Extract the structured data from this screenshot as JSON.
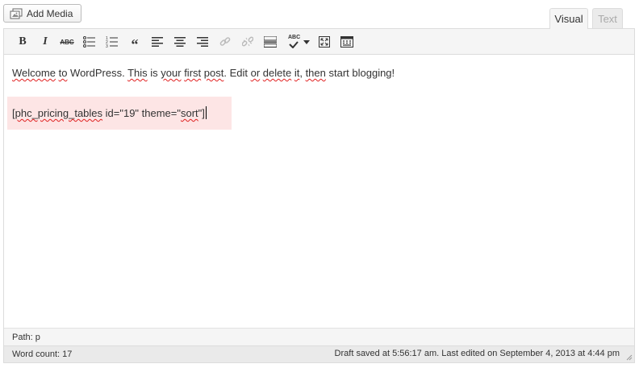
{
  "toolbar_top": {
    "add_media_label": "Add Media"
  },
  "tabs": {
    "visual": "Visual",
    "text": "Text"
  },
  "editor_toolbar": {
    "buttons": [
      {
        "name": "bold",
        "icon": "bold-icon"
      },
      {
        "name": "italic",
        "icon": "italic-icon"
      },
      {
        "name": "strikethrough",
        "icon": "strikethrough-icon",
        "glyph": "ABC"
      },
      {
        "name": "bulleted-list",
        "icon": "bulleted-list-icon"
      },
      {
        "name": "numbered-list",
        "icon": "numbered-list-icon"
      },
      {
        "name": "blockquote",
        "icon": "blockquote-icon"
      },
      {
        "name": "align-left",
        "icon": "align-left-icon"
      },
      {
        "name": "align-center",
        "icon": "align-center-icon"
      },
      {
        "name": "align-right",
        "icon": "align-right-icon"
      },
      {
        "name": "insert-link",
        "icon": "link-icon",
        "disabled": true
      },
      {
        "name": "remove-link",
        "icon": "unlink-icon",
        "disabled": true
      },
      {
        "name": "insert-more",
        "icon": "read-more-icon"
      },
      {
        "name": "spellcheck",
        "icon": "spellcheck-icon",
        "glyph": "ABC"
      },
      {
        "name": "fullscreen",
        "icon": "fullscreen-icon"
      },
      {
        "name": "kitchen-sink",
        "icon": "kitchen-sink-icon"
      }
    ]
  },
  "content": {
    "paragraph": {
      "w1": "Welcome",
      "w2": " ",
      "w3": "to",
      "w4": " WordPress. ",
      "w5": "This",
      "w6": " is ",
      "w7": "your",
      "w8": " ",
      "w9": "first",
      "w10": " ",
      "w11": "post",
      "w12": ". Edit ",
      "w13": "or",
      "w14": " ",
      "w15": "delete",
      "w16": " ",
      "w17": "it",
      "w18": ", ",
      "w19": "then",
      "w20": " start blogging!"
    },
    "shortcode": {
      "s1": "[phc_pricing_tables",
      "s2": " id=\"19\" theme=\"",
      "s3": "sort",
      "s4": "\"]"
    }
  },
  "path_bar": {
    "label": "Path: p"
  },
  "status_bar": {
    "word_count": "Word count: 17",
    "draft_status": "Draft saved at 5:56:17 am. Last edited on September 4, 2013 at 4:44 pm"
  },
  "colors": {
    "spellcheck_underline": "#e02020",
    "shortcode_bg": "#fde5e5",
    "toolbar_bg": "#f5f5f5"
  }
}
